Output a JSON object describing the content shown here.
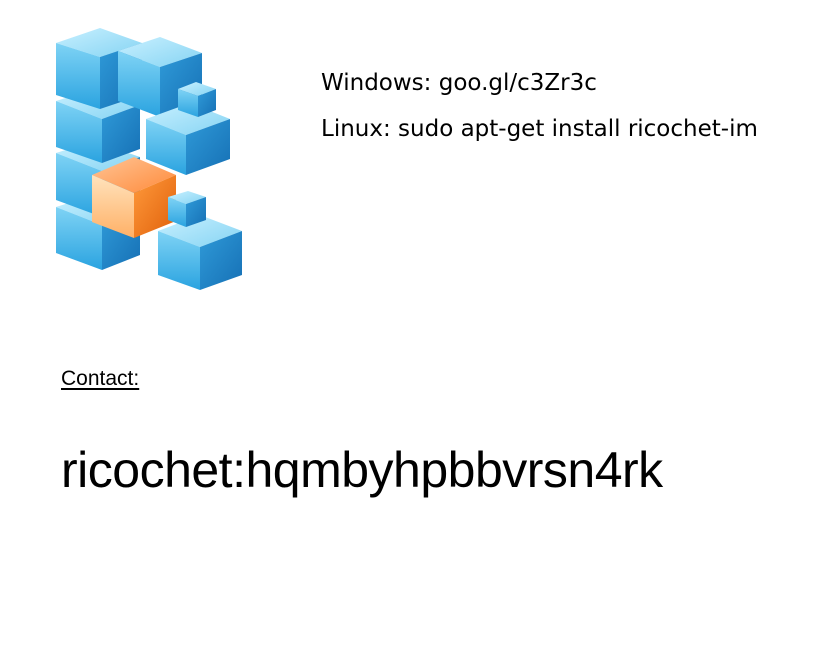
{
  "install": {
    "windows": "Windows: goo.gl/c3Zr3c",
    "linux": "Linux: sudo apt-get install ricochet-im"
  },
  "contact": {
    "label": "Contact:",
    "id": "ricochet:hqmbyhpbbvrsn4rk"
  },
  "logo": {
    "icon": "cube-stack-logo",
    "colors": {
      "blue_top": "#9fe0f8",
      "blue_left": "#3cb4e8",
      "blue_right": "#1d86c8",
      "orange_top": "#ffb07a",
      "orange_left": "#ffd8a8",
      "orange_right": "#f06e10"
    }
  }
}
